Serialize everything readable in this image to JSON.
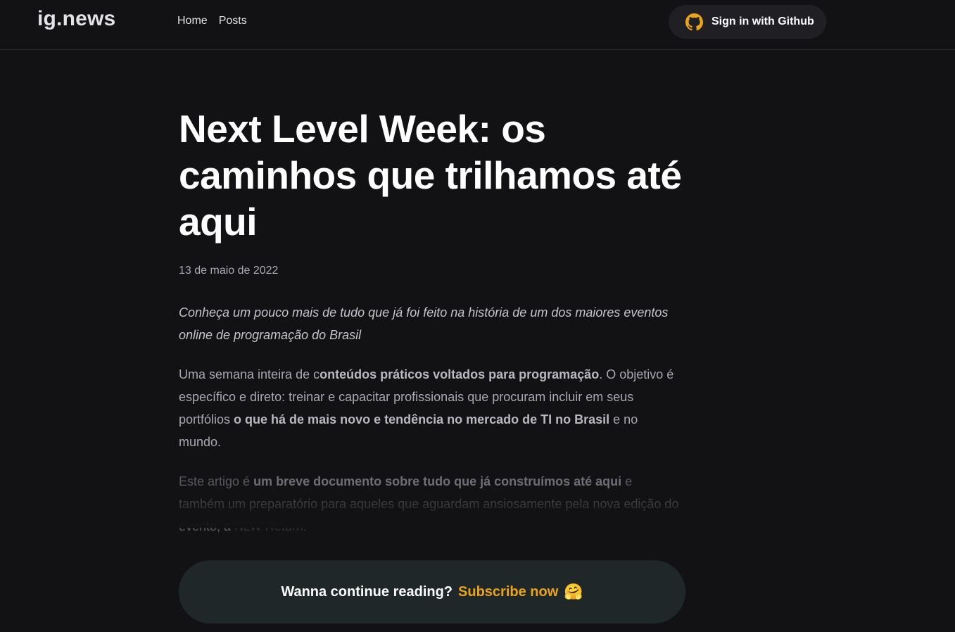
{
  "header": {
    "logo": "ig.news",
    "nav": [
      "Home",
      "Posts"
    ],
    "signin_label": "Sign in with Github",
    "signin_icon": "github-icon",
    "signin_icon_color": "#eba417"
  },
  "post": {
    "title": "Next Level Week: os caminhos que trilhamos até aqui",
    "date": "13 de maio de 2022",
    "lead": "Conheça um pouco mais de tudo que já foi feito na história de um dos maiores eventos online de programação do Brasil",
    "p1": {
      "a": "Uma semana inteira de c",
      "b": "onteúdos práticos voltados para programação",
      "c": ". O objetivo é específico e direto: treinar e capacitar profissionais que procuram incluir em seus portfólios ",
      "d": "o que há de mais novo e tendência no mercado de TI no Brasil",
      "e": " e no mundo."
    },
    "p2": {
      "a": "Este artigo é ",
      "b": "um breve documento sobre tudo que já construímos até aqui",
      "c": " e também um preparatório para aqueles que aguardam ansiosamente pela nova edição do evento, a ",
      "d": "NLW Return."
    }
  },
  "subscribe": {
    "question": "Wanna continue reading?",
    "cta": "Subscribe now",
    "emoji": "🤗",
    "accent": "#eba417"
  }
}
